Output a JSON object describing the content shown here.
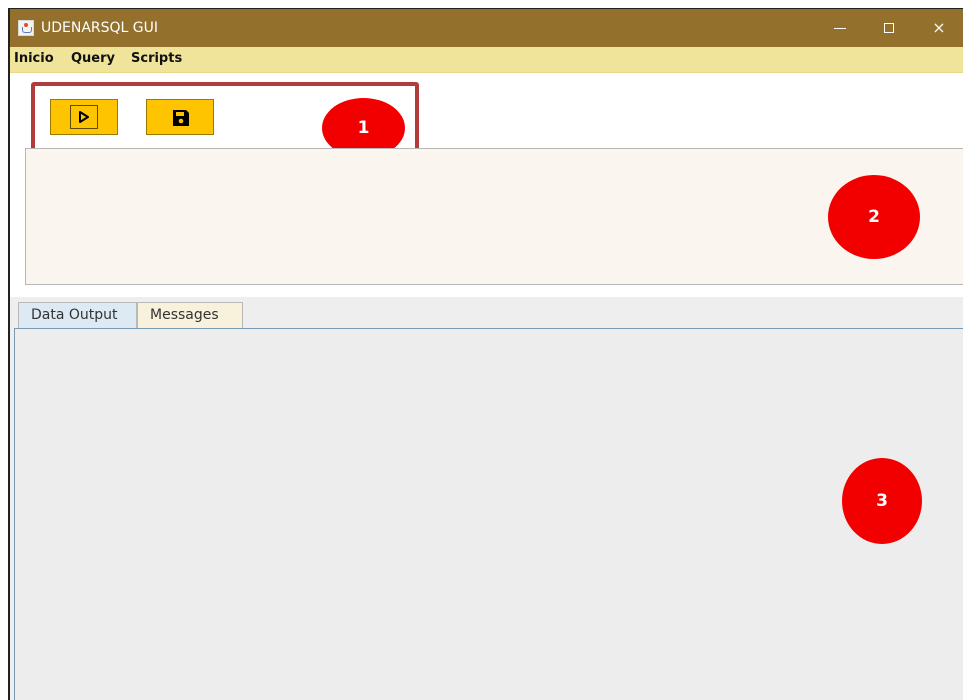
{
  "window": {
    "title": "UDENARSQL GUI",
    "controls": {
      "minimize": "minimize",
      "maximize": "maximize",
      "close": "×"
    }
  },
  "menu": {
    "items": [
      "Inicio",
      "Query",
      "Scripts"
    ]
  },
  "toolbar": {
    "run_icon": "play-icon",
    "save_icon": "save-icon"
  },
  "annotations": {
    "badges": [
      "1",
      "2",
      "3"
    ]
  },
  "tabs": [
    "Data Output",
    "Messages"
  ],
  "colors": {
    "titlebar": "#94702d",
    "menubar": "#f0e49b",
    "button": "#ffc400",
    "highlight": "#b13c3c",
    "badge": "#f20000",
    "editor": "#faf6ef",
    "output": "#eeeeee"
  }
}
